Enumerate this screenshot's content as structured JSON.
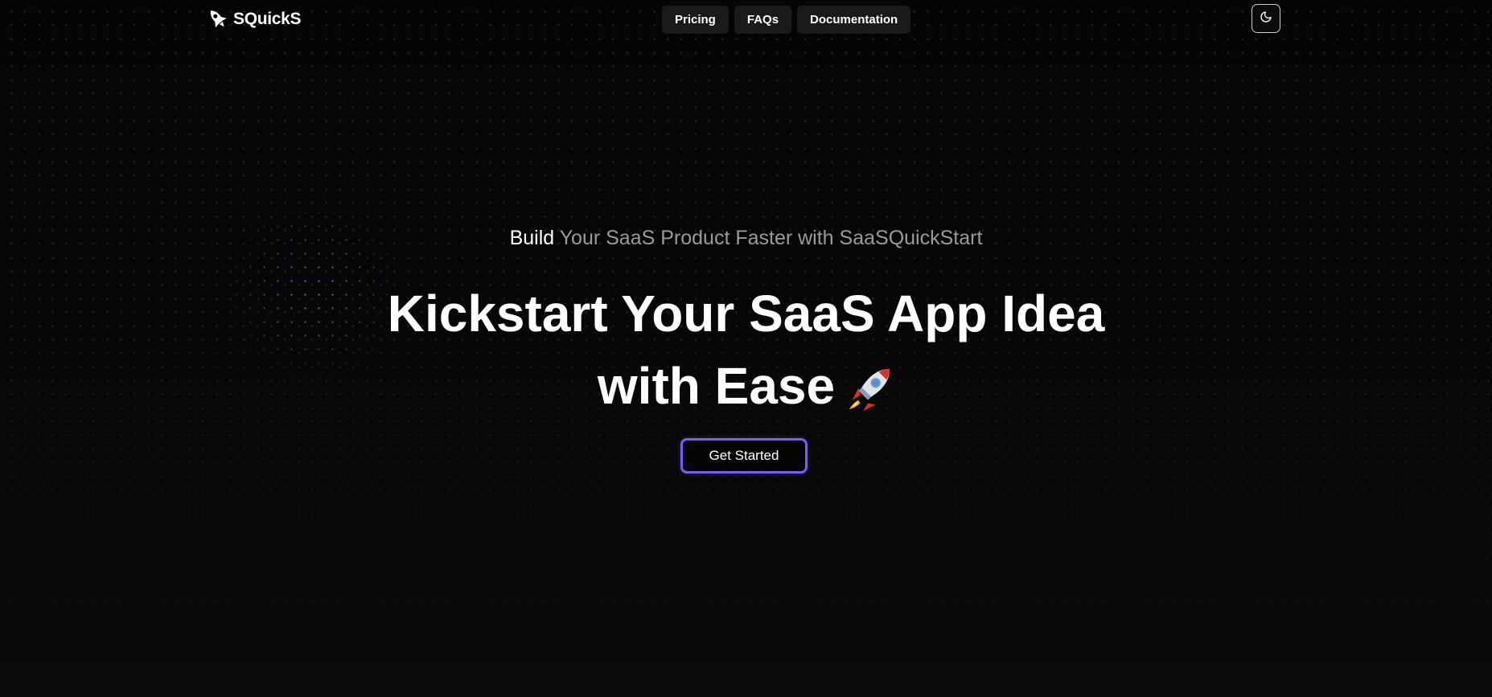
{
  "brand": {
    "name": "SQuickS",
    "logo_icon": "rocket-icon"
  },
  "nav": {
    "items": [
      {
        "label": "Pricing"
      },
      {
        "label": "FAQs"
      },
      {
        "label": "Documentation"
      }
    ]
  },
  "theme_toggle": {
    "icon": "moon-icon"
  },
  "hero": {
    "tagline_strong": "Build",
    "tagline_rest": "Your SaaS Product Faster with SaaSQuickStart",
    "headline_line1": "Kickstart Your SaaS App Idea",
    "headline_line2": "with Ease",
    "headline_emoji_icon": "rocket-emoji-icon",
    "cta_label": "Get Started"
  },
  "colors": {
    "background": "#060606",
    "accent": "#7d5cf5",
    "nav_item_bg": "#1a1a1a",
    "muted_text": "#9a9a9a",
    "dot_accent": "#786eff"
  }
}
